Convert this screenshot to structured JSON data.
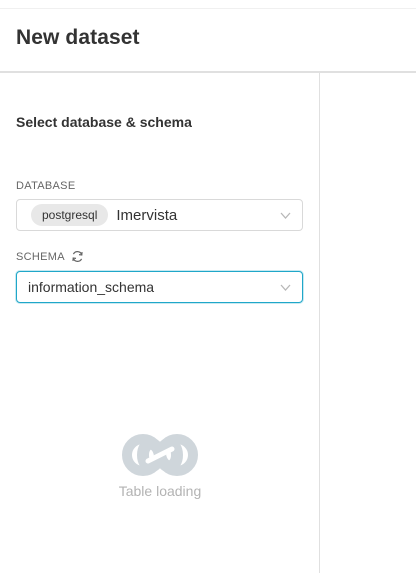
{
  "header": {
    "title": "New dataset"
  },
  "left_panel": {
    "section_title": "Select database & schema",
    "database": {
      "label": "DATABASE",
      "engine_tag": "postgresql",
      "value": "Imervista",
      "chevron_icon": "chevron-down-icon"
    },
    "schema": {
      "label": "SCHEMA",
      "refresh_icon": "refresh-icon",
      "value": "information_schema",
      "chevron_icon": "chevron-down-icon"
    },
    "loading": {
      "icon": "loading-infinity-icon",
      "text": "Table loading"
    }
  },
  "colors": {
    "focus_border": "#20a7c9",
    "loading_icon": "#cfd6db",
    "muted_text": "#b3b3b3"
  }
}
